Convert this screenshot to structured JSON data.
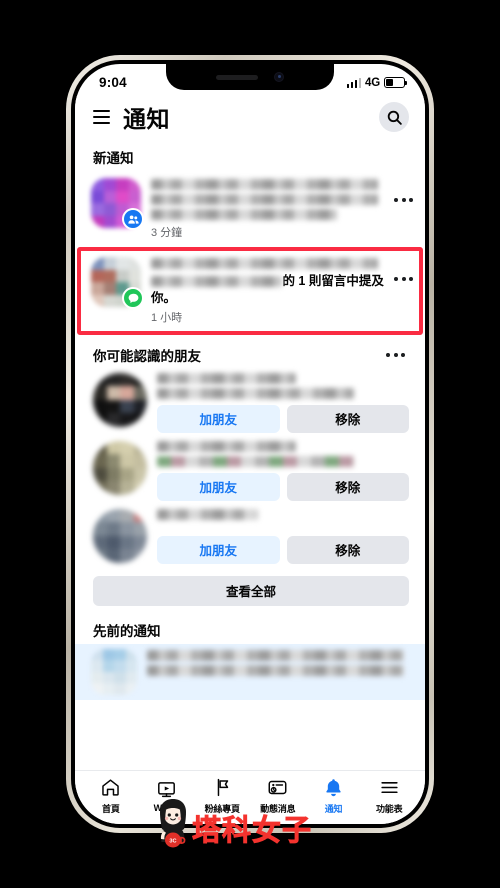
{
  "device": {
    "status_bar": {
      "time": "9:04",
      "network": "4G",
      "battery_percent": 42,
      "signal_bars": 3
    }
  },
  "header": {
    "menu_icon": "hamburger-icon",
    "title": "通知",
    "search_icon": "search-icon"
  },
  "sections": {
    "new_notifications": {
      "title": "新通知",
      "items": [
        {
          "id": "notif-group-post",
          "badge_icon": "group-people-icon",
          "badge_color": "#1778f2",
          "text": "",
          "time": "3 分鐘",
          "menu_icon": "ellipsis-icon",
          "blurred": true,
          "highlighted": false
        },
        {
          "id": "notif-comment-mention",
          "badge_icon": "comment-bubble-icon",
          "badge_color": "#20c659",
          "text": "的 1 則留言中提及",
          "text2": "你。",
          "time": "1 小時",
          "menu_icon": "ellipsis-icon",
          "blurred": true,
          "highlighted": true,
          "highlight_color": "#fa2b42"
        }
      ]
    },
    "people_you_may_know": {
      "title": "你可能認識的朋友",
      "menu_icon": "ellipsis-icon",
      "add_label": "加朋友",
      "remove_label": "移除",
      "see_all_label": "查看全部",
      "items": [
        {
          "id": "pymk-1",
          "name_blurred": true
        },
        {
          "id": "pymk-2",
          "name_blurred": true
        },
        {
          "id": "pymk-3",
          "name_blurred": true
        }
      ]
    },
    "earlier_notifications": {
      "title": "先前的通知",
      "items": [
        {
          "id": "earlier-1",
          "blurred": true,
          "unread": true
        }
      ]
    }
  },
  "bottom_nav": {
    "active": "通知",
    "items": [
      {
        "label": "首頁",
        "icon": "home-icon",
        "active": false
      },
      {
        "label": "Watch",
        "icon": "watch-play-icon",
        "active": false
      },
      {
        "label": "粉絲專頁",
        "icon": "flag-icon",
        "active": false
      },
      {
        "label": "動態消息",
        "icon": "feed-clock-icon",
        "active": false
      },
      {
        "label": "通知",
        "icon": "bell-icon",
        "active": true
      },
      {
        "label": "功能表",
        "icon": "menu-bars-icon",
        "active": false
      }
    ],
    "active_color": "#1877f2"
  },
  "watermark": {
    "text": "塔科女子",
    "color": "#f4332e",
    "mug_label": "3C",
    "figure_icon": "girl-mascot-icon"
  }
}
